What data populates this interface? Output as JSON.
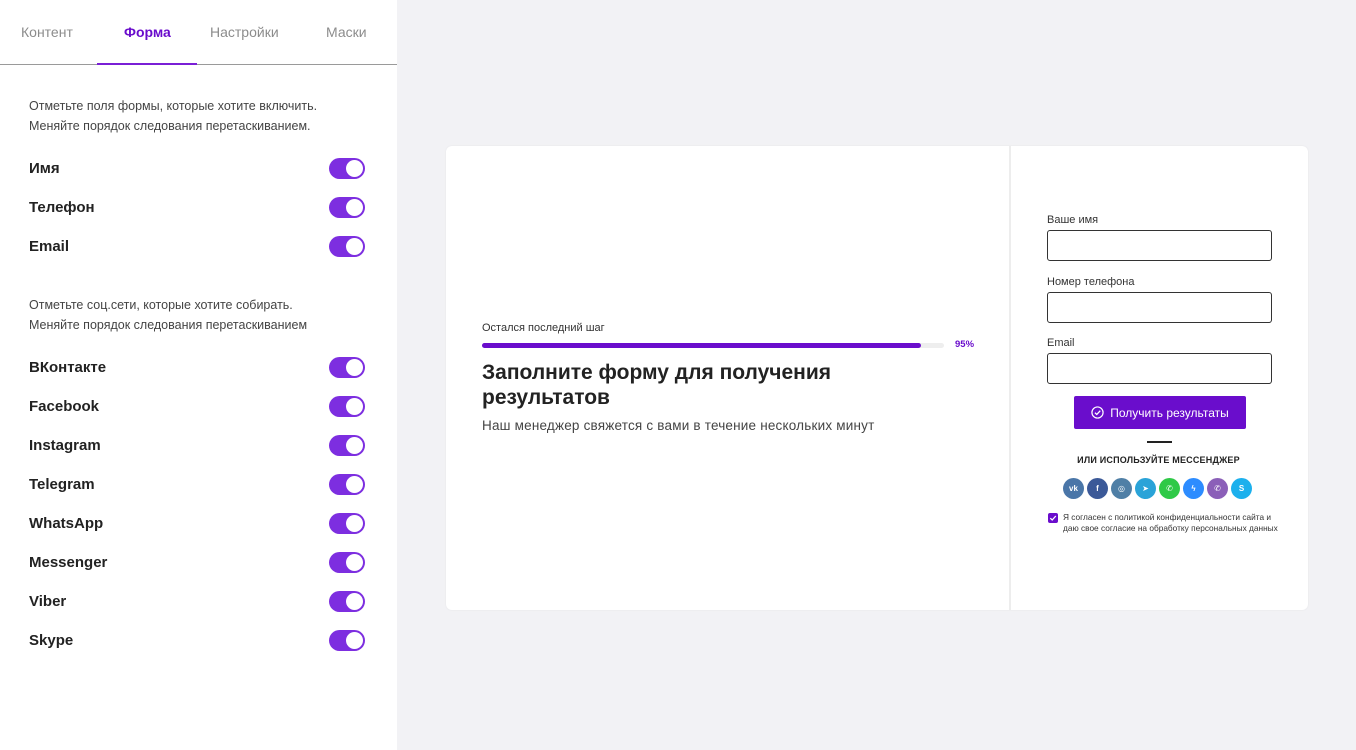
{
  "tabs": [
    "Контент",
    "Форма",
    "Настройки",
    "Маски"
  ],
  "active_tab": "Форма",
  "form_fields": {
    "hint_line1": "Отметьте поля формы, которые хотите включить.",
    "hint_line2": "Меняйте порядок следования перетаскиванием.",
    "items": [
      {
        "label": "Имя",
        "enabled": true
      },
      {
        "label": "Телефон",
        "enabled": true
      },
      {
        "label": "Email",
        "enabled": true
      }
    ]
  },
  "social_fields": {
    "hint_line1": "Отметьте соц.сети, которые хотите собирать.",
    "hint_line2": "Меняйте порядок следования перетаскиванием",
    "items": [
      {
        "label": "ВКонтакте",
        "enabled": true
      },
      {
        "label": "Facebook",
        "enabled": true
      },
      {
        "label": "Instagram",
        "enabled": true
      },
      {
        "label": "Telegram",
        "enabled": true
      },
      {
        "label": "WhatsApp",
        "enabled": true
      },
      {
        "label": "Messenger",
        "enabled": true
      },
      {
        "label": "Viber",
        "enabled": true
      },
      {
        "label": "Skype",
        "enabled": true
      }
    ]
  },
  "preview": {
    "step_label": "Остался последний шаг",
    "progress_percent": 95,
    "progress_text": "95%",
    "heading": "Заполните форму для получения результатов",
    "subheading": "Наш менеджер свяжется с вами в течение нескольких минут",
    "fields": [
      {
        "label": "Ваше имя",
        "value": ""
      },
      {
        "label": "Номер телефона",
        "value": ""
      },
      {
        "label": "Email",
        "value": ""
      }
    ],
    "submit_label": "Получить результаты",
    "messenger_caption": "ИЛИ ИСПОЛЬЗУЙТЕ МЕССЕНДЖЕР",
    "messengers": [
      {
        "name": "vk-icon",
        "glyph": "vk",
        "color": "#4a76a8"
      },
      {
        "name": "facebook-icon",
        "glyph": "f",
        "color": "#3b5998"
      },
      {
        "name": "instagram-icon",
        "glyph": "◎",
        "color": "#4f7fa6"
      },
      {
        "name": "telegram-icon",
        "glyph": "➤",
        "color": "#2aa3d8"
      },
      {
        "name": "whatsapp-icon",
        "glyph": "✆",
        "color": "#2fc947"
      },
      {
        "name": "messenger-icon",
        "glyph": "ϟ",
        "color": "#2d8cff"
      },
      {
        "name": "viber-icon",
        "glyph": "✆",
        "color": "#8b5fb8"
      },
      {
        "name": "skype-icon",
        "glyph": "S",
        "color": "#1cb0ed"
      }
    ],
    "consent_checked": true,
    "consent_text": "Я согласен с политикой конфиденциальности сайта и даю свое согласие на обработку персональных данных"
  },
  "colors": {
    "accent": "#6a0dcc",
    "toggle_on": "#7d2ee0",
    "background": "#f2f2f5"
  }
}
